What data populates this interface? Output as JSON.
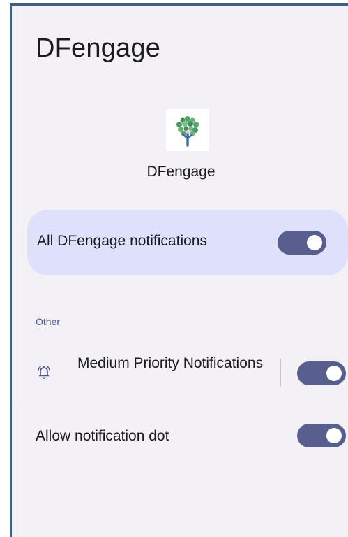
{
  "header": {
    "title": "DFengage"
  },
  "app": {
    "name": "DFengage",
    "icon": "tree-logo-icon"
  },
  "master_toggle": {
    "label": "All DFengage notifications",
    "on": true
  },
  "section": {
    "label": "Other"
  },
  "channel": {
    "label": "Medium Priority Notifications",
    "icon": "bell-ring-icon",
    "on": true
  },
  "notification_dot": {
    "label": "Allow notification dot",
    "on": true
  },
  "colors": {
    "background": "#f3f1f6",
    "card": "#dfe0fb",
    "switch_track": "#585f8f",
    "section_label": "#4b5590",
    "frame_border": "#3c5f86"
  }
}
